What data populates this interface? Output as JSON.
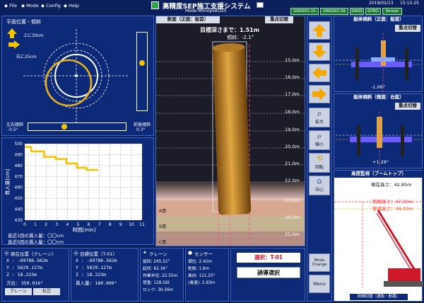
{
  "menu": {
    "file": "File",
    "mode": "Mode",
    "config": "Config",
    "help": "Help"
  },
  "app": {
    "title": "高精度SEP施工支援システム",
    "subtitle": "Mode:Monopile(2D)"
  },
  "datetime": {
    "date": "2019/02/13",
    "time": "15:15:25"
  },
  "status_buttons": [
    "GNSS01:10",
    "GNSS02:09",
    "GNSS",
    "GYRO",
    "Sensor"
  ],
  "plan": {
    "title": "平面位置・傾斜",
    "up_label": "上に30cm",
    "right_label": "右に25cm",
    "lr_tilt_label": "左右傾斜",
    "lr_tilt_value": "-0.5°",
    "fb_tilt_label": "前後傾斜",
    "fb_tilt_value": "0.3°"
  },
  "penetration_chart": {
    "ylabel": "貫入量[cm]",
    "xlabel": "時間[min]",
    "xticks": [
      "0",
      "1",
      "2",
      "3",
      "4",
      "5",
      "6",
      "7",
      "8",
      "9",
      "10",
      "11"
    ],
    "yticks": [
      "500",
      "490",
      "480",
      "470",
      "460",
      "450",
      "440",
      "430"
    ],
    "last_label": "直近1回の貫入量：",
    "last_value": "〇〇cm",
    "recent_label": "直近5回の貫入量：",
    "recent_value": "〇〇cm"
  },
  "chart_data": {
    "type": "line",
    "title": "",
    "xlabel": "時間[min]",
    "ylabel": "貫入量[cm]",
    "xlim": [
      0,
      11
    ],
    "ylim": [
      430,
      500
    ],
    "grid": true,
    "x": [
      0,
      0.6,
      0.6,
      1.8,
      1.8,
      2.9,
      2.9,
      3.9,
      3.9,
      4.9,
      4.9,
      5.8,
      5.8,
      6.9
    ],
    "y": [
      497,
      497,
      493,
      493,
      488,
      488,
      486,
      486,
      482,
      482,
      478,
      478,
      476,
      476
    ]
  },
  "elevation": {
    "title": "断面（正面：船首）",
    "toggle_label": "重点切替",
    "distance_label": "目標深さまで：1.51m",
    "tilt_label": "傾斜：-2.1°",
    "levels": [
      "15.0m",
      "16.0m",
      "17.0m",
      "18.0m",
      "19.0m",
      "20.0m",
      "21.0m",
      "22.0m",
      "23.0m",
      "24.0m",
      "25.0m"
    ],
    "layers": [
      "A層",
      "B層",
      "C層"
    ]
  },
  "tools": {
    "zoom_in": "拡大",
    "zoom_out": "縮小",
    "rotate": "回転",
    "center": "中心"
  },
  "side_buttons": {
    "mode_change": "Mode Change",
    "menu": "Menu"
  },
  "hull_front": {
    "title": "船体傾斜（正面：船首）",
    "toggle": "重点切替",
    "value": "-1.06°"
  },
  "hull_right": {
    "title": "船体傾斜（側面：右舷）",
    "toggle": "重点切替",
    "value": "+1.28°"
  },
  "crane_height": {
    "title": "高度監視（ブームトップ）",
    "current_label": "現在高さ：",
    "current_value": "42.85m",
    "limit_label": "制限高さ：",
    "limit_value": "47.00m",
    "warn_label": "警戒高さ：",
    "warn_value": "44.00m",
    "footer": "詳細切替（運転・航路）"
  },
  "gps_crane": {
    "title": "現在位置（クレーン）",
    "x_label": "X",
    "x_value": ": -69786.562m",
    "y_label": "Y",
    "y_value": ": 5629.127m",
    "z_label": "Z",
    "z_value": ": 18.223m",
    "dir_label": "方位",
    "dir_value": ": 359.016°",
    "btn1": "クレーン",
    "btn2": "杭芯"
  },
  "gps_target": {
    "title": "目標位置（T-01）",
    "x_label": "X",
    "x_value": ": -69786.562m",
    "y_label": "Y",
    "y_value": ": 5629.127m",
    "z_label": "Z",
    "z_value": ": 18.223m",
    "pen_label": "貫入量",
    "pen_value": ": 180.000°"
  },
  "crane": {
    "title": "クレーン",
    "r1_label": "旋回",
    "r1_value": ": 245.51°",
    "r2_label": "起伏",
    "r2_value": ": 62.34°",
    "r3_label": "作業半径",
    "r3_value": ": 22.55m",
    "r4_label": "荷重",
    "r4_value": ": 128.56t",
    "r5_label": "ロック",
    "r5_value": ": 30.56m"
  },
  "sensor": {
    "title": "センサー",
    "r1_label": "潮位",
    "r1_value": ": 2.42m",
    "r2_label": "乾舷",
    "r2_value": ": 1.8m",
    "r3_label": "風向",
    "r3_value": ": 111.25°",
    "r4_label": "(風速)",
    "r4_value": ": 2.83m"
  },
  "selection": {
    "selected": "選択：T-01",
    "button": "誘導選択"
  },
  "colors": {
    "bg": "#0a1f5c",
    "panel": "#0d2a78",
    "pile": "#c8902a",
    "accent": "#f5c400",
    "limit": "#ff2a2a"
  }
}
